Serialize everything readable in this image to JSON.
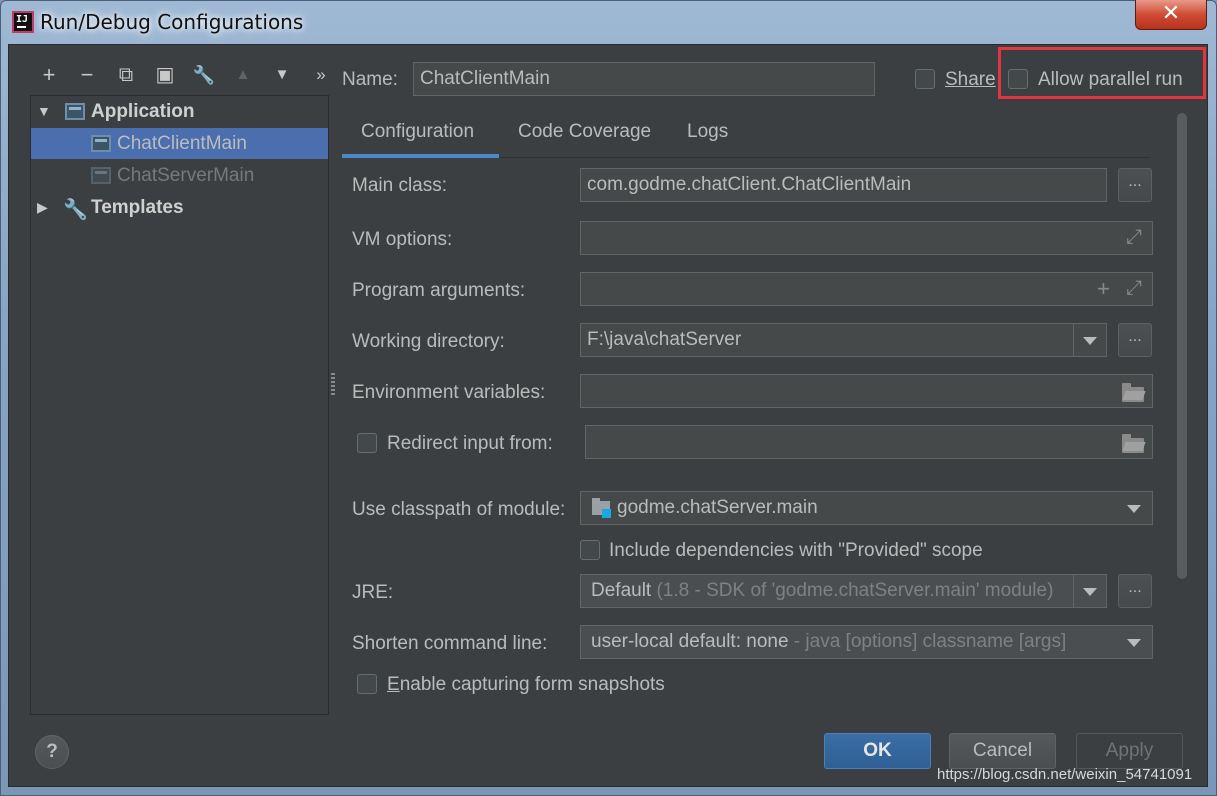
{
  "window": {
    "title": "Run/Debug Configurations",
    "close_glyph": "✕",
    "app_icon_text": "IJ"
  },
  "toolbar": {
    "add": "+",
    "remove": "−",
    "copy": "⧉",
    "save": "▣",
    "edit_defaults": "🔧",
    "move_up": "▲",
    "move_down": "▼",
    "more": "»"
  },
  "tree": {
    "groups": [
      {
        "label": "Application",
        "expanded": true,
        "children": [
          {
            "label": "ChatClientMain",
            "selected": true
          },
          {
            "label": "ChatServerMain",
            "selected": false
          }
        ]
      },
      {
        "label": "Templates",
        "expanded": false
      }
    ]
  },
  "header": {
    "name_label": "Name:",
    "name_value": "ChatClientMain",
    "share_label": "Share",
    "share_checked": false,
    "allow_parallel_label": "Allow parallel run",
    "allow_parallel_checked": false
  },
  "tabs": [
    {
      "label": "Configuration",
      "active": true
    },
    {
      "label": "Code Coverage",
      "active": false
    },
    {
      "label": "Logs",
      "active": false
    }
  ],
  "form": {
    "main_class_label": "Main class:",
    "main_class_value": "com.godme.chatClient.ChatClientMain",
    "vm_options_label": "VM options:",
    "vm_options_value": "",
    "program_args_label": "Program arguments:",
    "program_args_value": "",
    "working_dir_label": "Working directory:",
    "working_dir_value": "F:\\java\\chatServer",
    "env_vars_label": "Environment variables:",
    "env_vars_value": "",
    "redirect_label": "Redirect input from:",
    "redirect_checked": false,
    "redirect_value": "",
    "classpath_label": "Use classpath of module:",
    "classpath_value": "godme.chatServer.main",
    "include_deps_label": "Include dependencies with \"Provided\" scope",
    "include_deps_checked": false,
    "jre_label": "JRE:",
    "jre_value_main": "Default",
    "jre_value_detail": "(1.8 - SDK of 'godme.chatServer.main' module)",
    "shorten_label": "Shorten command line:",
    "shorten_value_main": "user-local default: none",
    "shorten_value_detail": "- java [options] classname [args]",
    "snapshots_label": "Enable capturing form snapshots",
    "snapshots_checked": false,
    "browse_dots": "..."
  },
  "buttons": {
    "help": "?",
    "ok": "OK",
    "cancel": "Cancel",
    "apply": "Apply"
  },
  "watermark": "https://blog.csdn.net/weixin_54741091",
  "colors": {
    "dialog_bg": "#3c3f41",
    "selection": "#4b6eaf",
    "tab_underline": "#4a88c7",
    "ok_button": "#365880",
    "highlight_box": "#e0363f"
  }
}
